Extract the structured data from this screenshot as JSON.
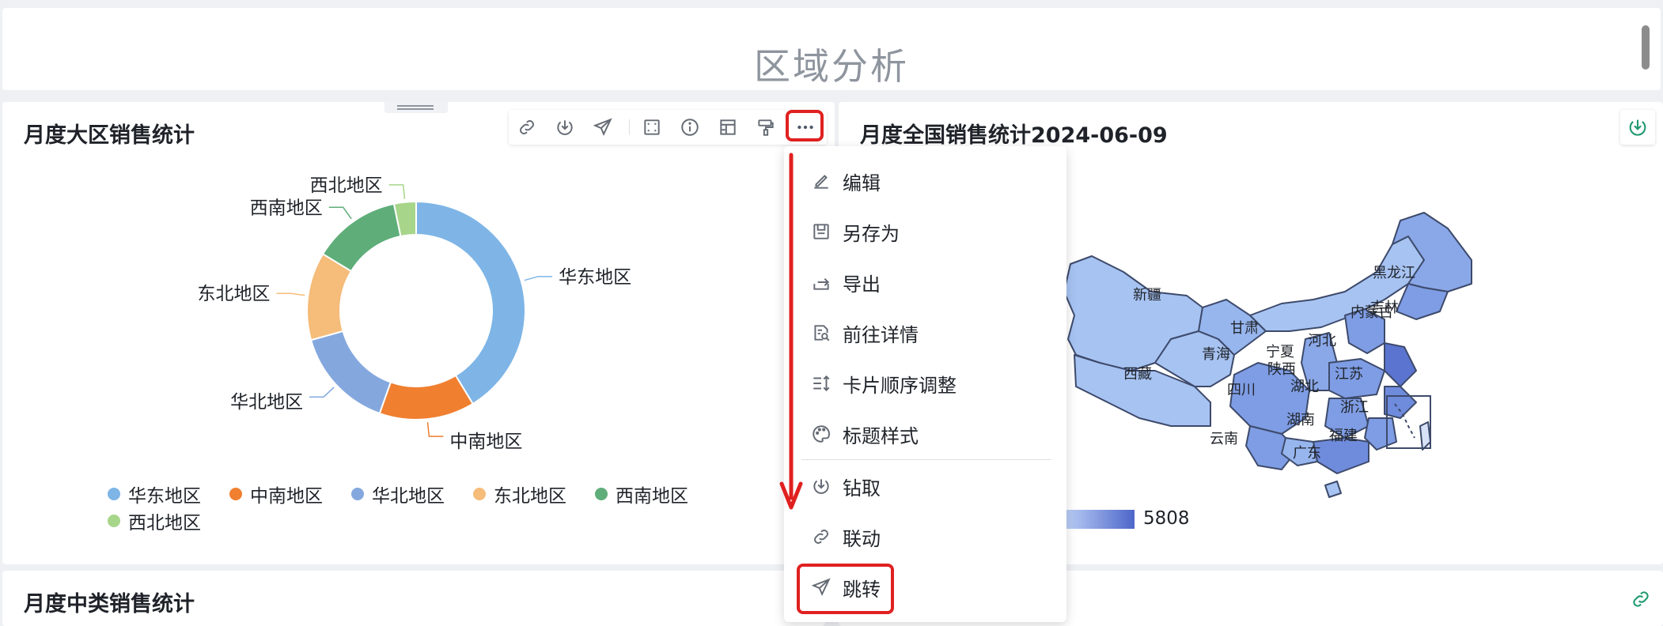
{
  "page": {
    "title": "区域分析"
  },
  "region_card": {
    "title": "月度大区销售统计",
    "slice_labels": [
      "华东地区",
      "中南地区",
      "华北地区",
      "东北地区",
      "西南地区",
      "西北地区"
    ],
    "legend": [
      "华东地区",
      "中南地区",
      "华北地区",
      "东北地区",
      "西南地区",
      "西北地区"
    ]
  },
  "chart_data": {
    "type": "pie",
    "categories": [
      "华东地区",
      "中南地区",
      "华北地区",
      "东北地区",
      "西南地区",
      "西北地区"
    ],
    "values": [
      38,
      13,
      14,
      12,
      12,
      3
    ],
    "colors": [
      "#7eb5e6",
      "#f07f30",
      "#84a8de",
      "#f5bc7a",
      "#5fae7a",
      "#a7d68a"
    ],
    "donut": true,
    "legend_position": "bottom"
  },
  "toolbar": {
    "icons": [
      "link-icon",
      "drill-icon",
      "send-icon",
      "expand-icon",
      "info-icon",
      "table-icon",
      "format-brush-icon",
      "more-icon"
    ]
  },
  "context_menu": {
    "items": [
      "编辑",
      "另存为",
      "导出",
      "前往详情",
      "卡片顺序调整",
      "标题样式",
      "钻取",
      "联动",
      "跳转"
    ]
  },
  "national_card": {
    "title": "月度全国销售统计2024-06-09",
    "legend_max": "5808",
    "province_labels": [
      "新疆",
      "西藏",
      "甘肃",
      "青海",
      "内蒙古",
      "黑龙江",
      "吉林",
      "宁夏",
      "河北",
      "陕西",
      "四川",
      "湖北",
      "江苏",
      "浙江",
      "湖南",
      "福建",
      "云南",
      "广东"
    ]
  },
  "mid_card": {
    "title": "月度中类销售统计"
  },
  "colors": {
    "highlight": "#e02020",
    "accent": "#1e9a6e"
  }
}
